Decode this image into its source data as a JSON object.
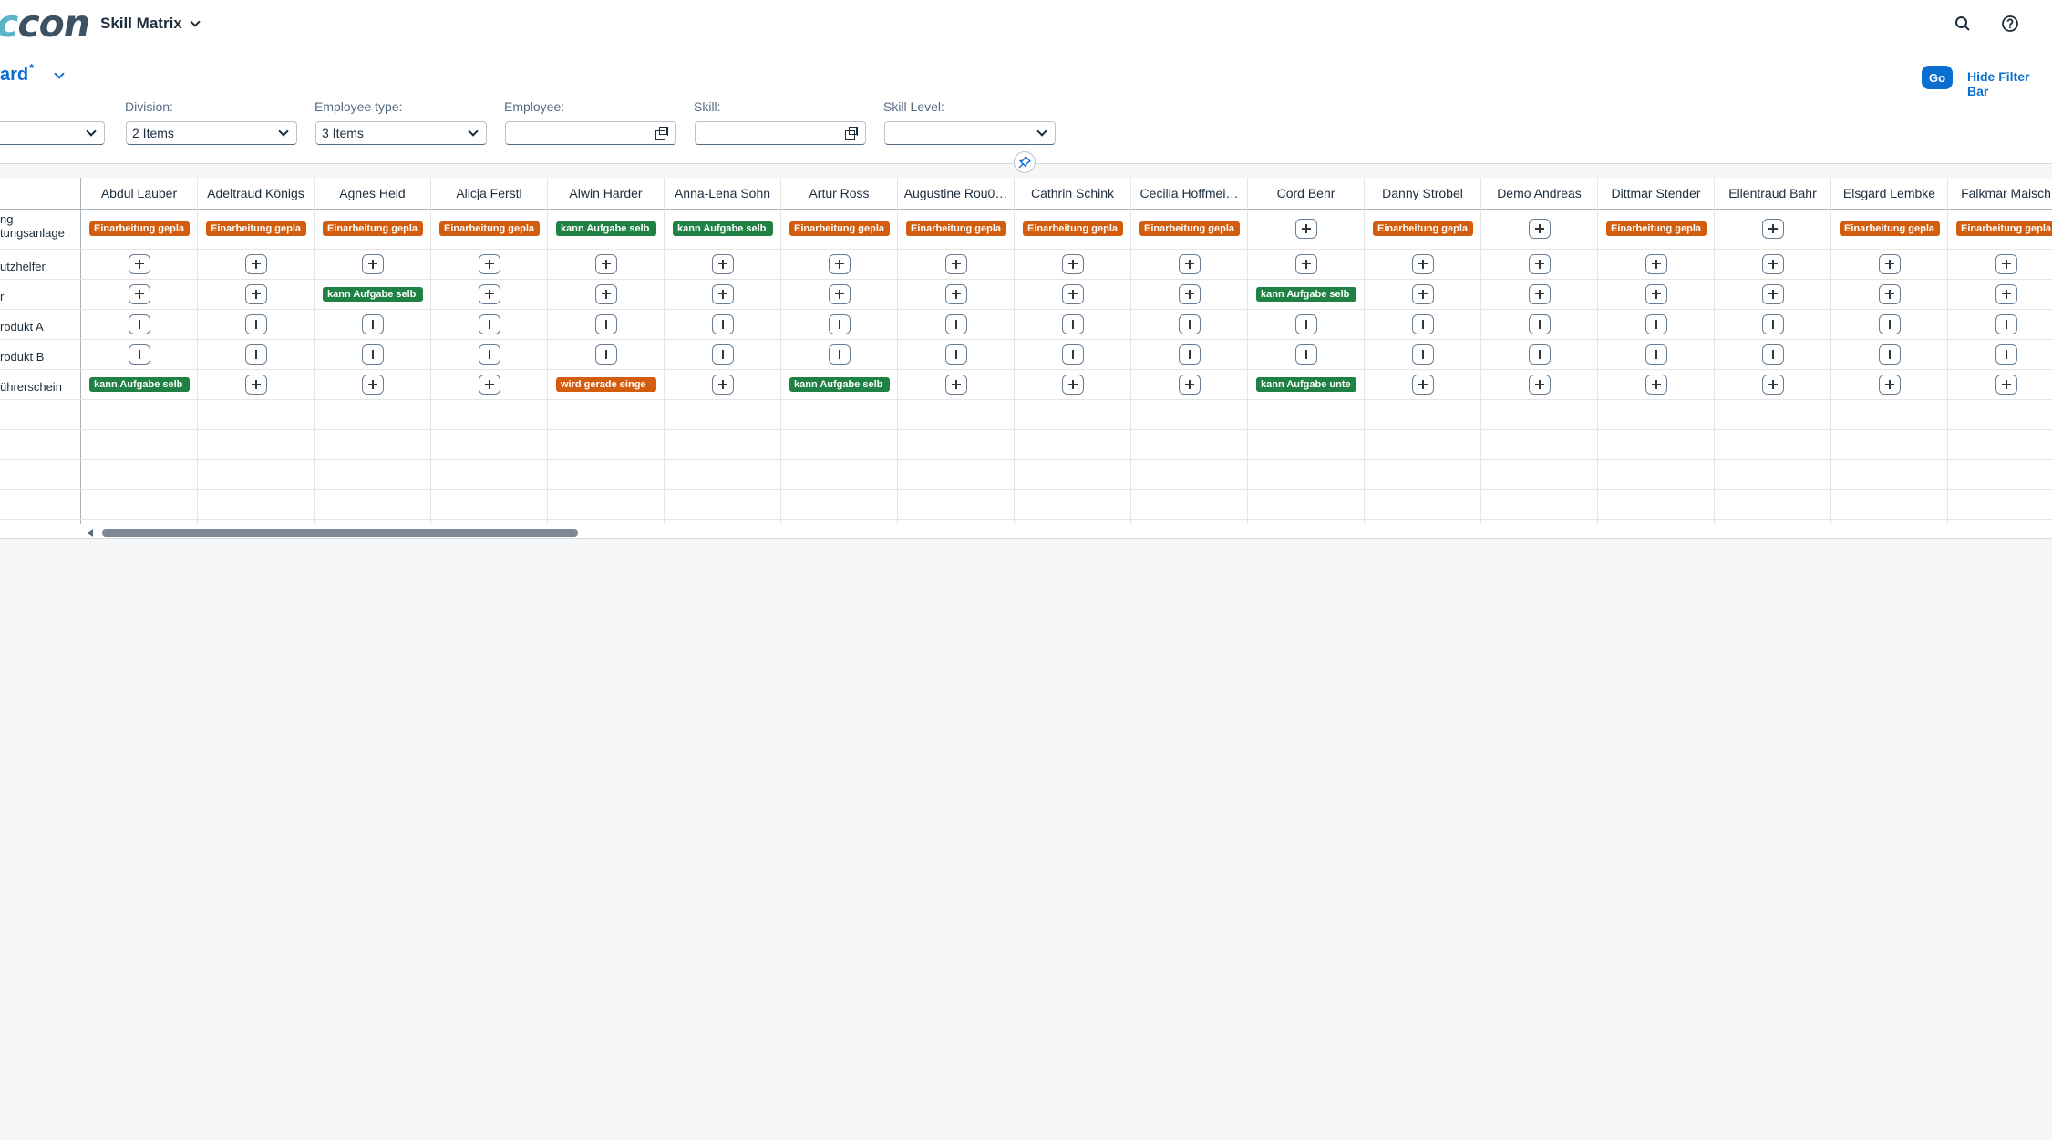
{
  "shell": {
    "logo_part1": "c",
    "logo_part2": "con",
    "app_title": "Skill Matrix"
  },
  "header": {
    "variant_title": "ard",
    "variant_modified_marker": "*",
    "go_label": "Go",
    "hide_filter_label": "Hide Filter Bar"
  },
  "filters": [
    {
      "label": "",
      "value": "",
      "type": "select"
    },
    {
      "label": "Division:",
      "value": "2 Items",
      "type": "select"
    },
    {
      "label": "Employee type:",
      "value": "3 Items",
      "type": "select"
    },
    {
      "label": "Employee:",
      "value": "",
      "type": "valuehelp"
    },
    {
      "label": "Skill:",
      "value": "",
      "type": "valuehelp"
    },
    {
      "label": "Skill Level:",
      "value": "",
      "type": "select"
    }
  ],
  "table": {
    "columns": [
      "Abdul Lauber",
      "Adeltraud Königs",
      "Agnes Held",
      "Alicja Ferstl",
      "Alwin Harder",
      "Anna-Lena Sohn",
      "Artur Ross",
      "Augustine Rou0…",
      "Cathrin Schink",
      "Cecilia Hoffmei…",
      "Cord Behr",
      "Danny Strobel",
      "Demo Andreas",
      "Dittmar Stender",
      "Ellentraud Bahr",
      "Elsgard Lembke",
      "Falkmar Maisch"
    ],
    "rows": [
      {
        "label_line1": "ng",
        "label_line2": "tungsanlage",
        "cells": [
          "Einarbeitung gepla",
          "Einarbeitung gepla",
          "Einarbeitung gepla",
          "Einarbeitung gepla",
          "kann Aufgabe selb",
          "kann Aufgabe selb",
          "Einarbeitung gepla",
          "Einarbeitung gepla",
          "Einarbeitung gepla",
          "Einarbeitung gepla",
          "+",
          "Einarbeitung gepla",
          "+",
          "Einarbeitung gepla",
          "+",
          "Einarbeitung gepla",
          "Einarbeitung gepla"
        ]
      },
      {
        "label_line1": "utzhelfer",
        "label_line2": "",
        "cells": [
          "+",
          "+",
          "+",
          "+",
          "+",
          "+",
          "+",
          "+",
          "+",
          "+",
          "+",
          "+",
          "+",
          "+",
          "+",
          "+",
          "+"
        ]
      },
      {
        "label_line1": "r",
        "label_line2": "",
        "cells": [
          "+",
          "+",
          "kann Aufgabe selb",
          "+",
          "+",
          "+",
          "+",
          "+",
          "+",
          "+",
          "kann Aufgabe selb",
          "+",
          "+",
          "+",
          "+",
          "+",
          "+"
        ]
      },
      {
        "label_line1": "rodukt A",
        "label_line2": "",
        "cells": [
          "+",
          "+",
          "+",
          "+",
          "+",
          "+",
          "+",
          "+",
          "+",
          "+",
          "+",
          "+",
          "+",
          "+",
          "+",
          "+",
          "+"
        ]
      },
      {
        "label_line1": "rodukt B",
        "label_line2": "",
        "cells": [
          "+",
          "+",
          "+",
          "+",
          "+",
          "+",
          "+",
          "+",
          "+",
          "+",
          "+",
          "+",
          "+",
          "+",
          "+",
          "+",
          "+"
        ]
      },
      {
        "label_line1": "ührerschein",
        "label_line2": "",
        "cells": [
          "kann Aufgabe selb",
          "+",
          "+",
          "+",
          "wird gerade einge",
          "+",
          "kann Aufgabe selb",
          "+",
          "+",
          "+",
          "kann Aufgabe unte",
          "+",
          "+",
          "+",
          "+",
          "+",
          "+"
        ]
      }
    ]
  },
  "colors": {
    "orange": "#d35d0e",
    "green": "#1f8143",
    "accent": "#0a6ed1"
  },
  "scroll_position": 0
}
